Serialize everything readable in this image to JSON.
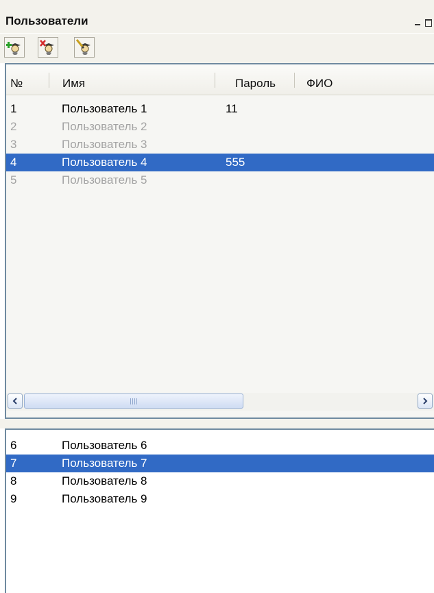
{
  "window": {
    "title": "Пользователи"
  },
  "toolbar": {
    "buttons": [
      {
        "name": "add-user-button",
        "icon": "user-add-icon"
      },
      {
        "name": "delete-user-button",
        "icon": "user-delete-icon"
      },
      {
        "name": "edit-user-button",
        "icon": "user-edit-icon"
      }
    ]
  },
  "top_list": {
    "columns": [
      "№",
      "Имя",
      "Пароль",
      "ФИО"
    ],
    "rows": [
      {
        "num": "1",
        "name": "Пользователь 1",
        "password": "11",
        "fio": "",
        "state": "normal"
      },
      {
        "num": "2",
        "name": "Пользователь 2",
        "password": "",
        "fio": "",
        "state": "disabled"
      },
      {
        "num": "3",
        "name": "Пользователь 3",
        "password": "",
        "fio": "",
        "state": "disabled"
      },
      {
        "num": "4",
        "name": "Пользователь 4",
        "password": "555",
        "fio": "",
        "state": "selected"
      },
      {
        "num": "5",
        "name": "Пользователь 5",
        "password": "",
        "fio": "",
        "state": "disabled"
      }
    ]
  },
  "bottom_list": {
    "rows": [
      {
        "num": "6",
        "name": "Пользователь 6",
        "state": "normal"
      },
      {
        "num": "7",
        "name": "Пользователь 7",
        "state": "selected"
      },
      {
        "num": "8",
        "name": "Пользователь 8",
        "state": "normal"
      },
      {
        "num": "9",
        "name": "Пользователь 9",
        "state": "normal"
      }
    ]
  },
  "colors": {
    "selection": "#316ac5",
    "disabled_text": "#a3a3a3",
    "panel_border": "#6f8aa0"
  }
}
